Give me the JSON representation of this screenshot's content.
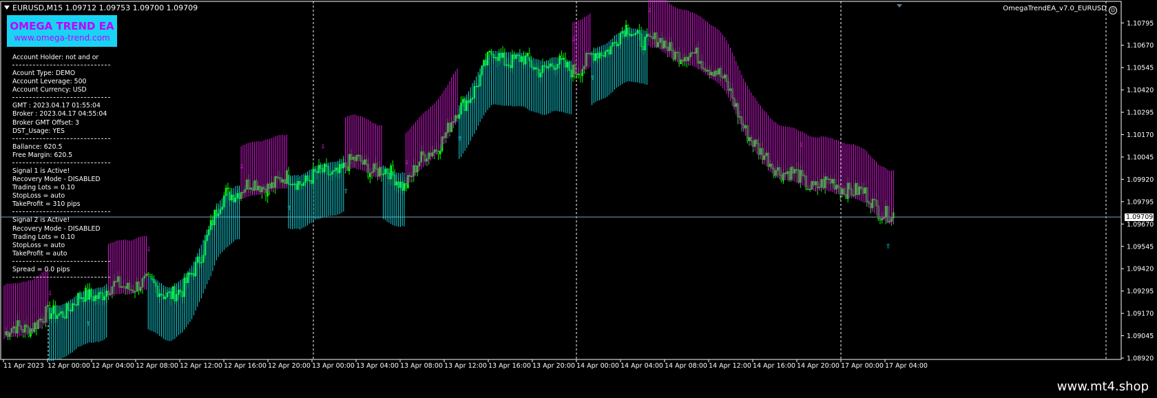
{
  "header": {
    "symbol_quote": "EURUSD,M15  1.09712 1.09753 1.09700 1.09709",
    "ea_name": "OmegaTrendEA_v7.0_EURUSD"
  },
  "brand": {
    "title": "OMEGA TREND EA",
    "url": "www.omega-trend.com"
  },
  "info_panel": {
    "groups": [
      [
        "Account Holder: not and or"
      ],
      [
        "Acount Type:  DEMO",
        "Account Leverage: 500",
        "Account Currency: USD"
      ],
      [
        "GMT : 2023.04.17 01:55:04",
        "Broker : 2023.04.17 04:55:04",
        "Broker GMT Offset: 3",
        "DST_Usage: YES"
      ],
      [
        "Ballance: 620.5",
        "Free Margin: 620.5"
      ],
      [
        "Signal 1 is Active!",
        "Recovery Mode - DISABLED",
        "Trading Lots = 0.10",
        "StopLoss = auto",
        "TakeProfit = 310 pips"
      ],
      [
        "Signal 2 is Active!",
        "Recovery Mode - DISABLED",
        "Trading Lots = 0.10",
        "StopLoss = auto",
        "TakeProfit = auto"
      ],
      [
        "Spread = 0.0 pips"
      ]
    ]
  },
  "price_axis": {
    "labels": [
      "1.10795",
      "1.10670",
      "1.10545",
      "1.10420",
      "1.10295",
      "1.10170",
      "1.10045",
      "1.09920",
      "1.09795",
      "1.09670",
      "1.09545",
      "1.09420",
      "1.09295",
      "1.09170",
      "1.09045",
      "1.08920"
    ],
    "current_price": "1.09709"
  },
  "time_axis": {
    "labels": [
      "11 Apr 2023",
      "12 Apr 00:00",
      "12 Apr 04:00",
      "12 Apr 08:00",
      "12 Apr 12:00",
      "12 Apr 16:00",
      "12 Apr 20:00",
      "13 Apr 00:00",
      "13 Apr 04:00",
      "13 Apr 08:00",
      "13 Apr 12:00",
      "13 Apr 16:00",
      "13 Apr 20:00",
      "14 Apr 00:00",
      "14 Apr 04:00",
      "14 Apr 08:00",
      "14 Apr 12:00",
      "14 Apr 16:00",
      "14 Apr 20:00",
      "17 Apr 00:00",
      "17 Apr 04:00"
    ]
  },
  "chart_data": {
    "type": "line",
    "title": "",
    "xlabel": "",
    "ylabel": "",
    "ylim": [
      1.0892,
      1.1085
    ],
    "x": [
      "11 Apr 2023",
      "12 Apr 00:00",
      "12 Apr 04:00",
      "12 Apr 08:00",
      "12 Apr 12:00",
      "12 Apr 16:00",
      "12 Apr 20:00",
      "13 Apr 00:00",
      "13 Apr 04:00",
      "13 Apr 08:00",
      "13 Apr 12:00",
      "13 Apr 16:00",
      "13 Apr 20:00",
      "14 Apr 00:00",
      "14 Apr 04:00",
      "14 Apr 08:00",
      "14 Apr 12:00",
      "14 Apr 16:00",
      "14 Apr 20:00",
      "17 Apr 00:00",
      "17 Apr 04:00"
    ],
    "series": [
      {
        "values": [
          1.0905,
          1.0915,
          1.0928,
          1.0934,
          1.0927,
          1.0985,
          1.099,
          1.0993,
          1.1002,
          1.099,
          1.102,
          1.1062,
          1.1055,
          1.1055,
          1.1075,
          1.1065,
          1.1055,
          1.1005,
          1.099,
          1.0988,
          1.0971
        ]
      }
    ],
    "current_price": 1.09709
  },
  "colors": {
    "background": "#000000",
    "candle": "#00ff00",
    "cloud_bull": "#19e6f0",
    "cloud_bear": "#e61ee6",
    "vgrid": "#ffffff",
    "price_line": "#7fa3b8"
  },
  "watermark": "www.mt4.shop"
}
